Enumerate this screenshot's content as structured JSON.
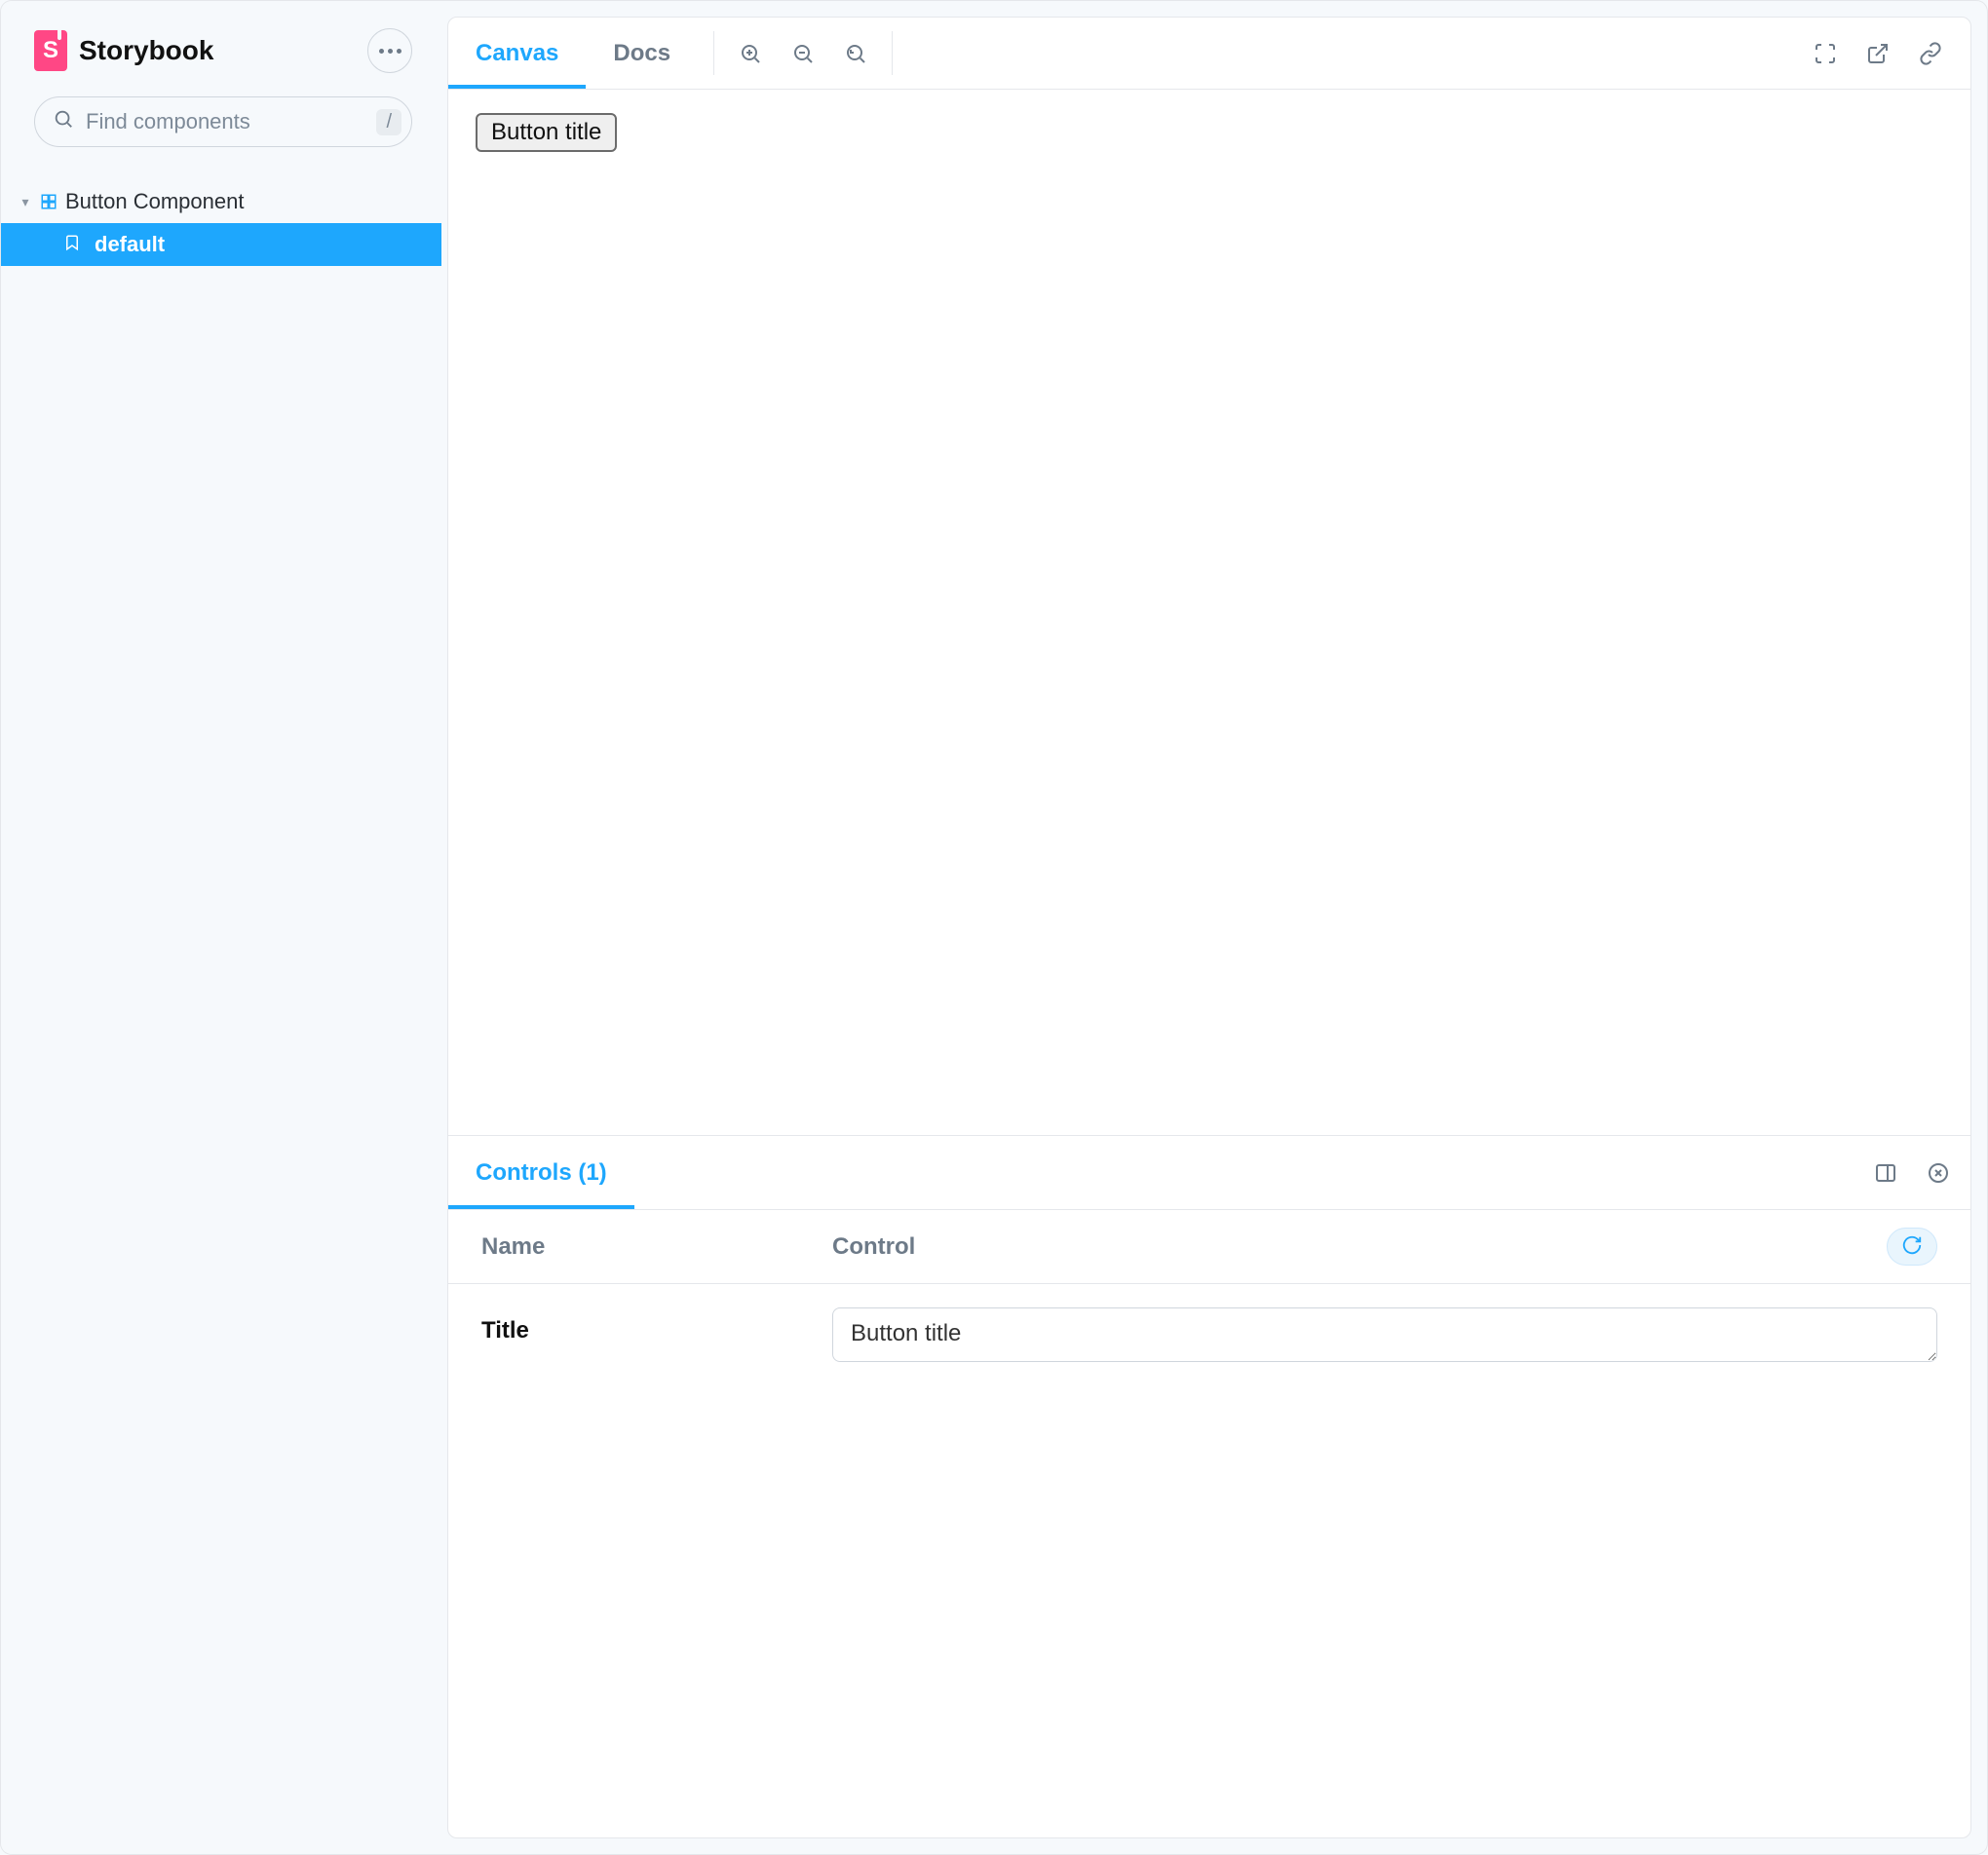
{
  "brand": {
    "name": "Storybook"
  },
  "search": {
    "placeholder": "Find components",
    "shortcut": "/"
  },
  "nav": {
    "component": "Button Component",
    "story": "default"
  },
  "toolbar": {
    "tabs": {
      "canvas": "Canvas",
      "docs": "Docs"
    }
  },
  "preview": {
    "button_label": "Button title"
  },
  "addons": {
    "tab_label": "Controls (1)",
    "header": {
      "name": "Name",
      "control": "Control"
    },
    "controls": [
      {
        "name": "Title",
        "value": "Button title"
      }
    ]
  }
}
